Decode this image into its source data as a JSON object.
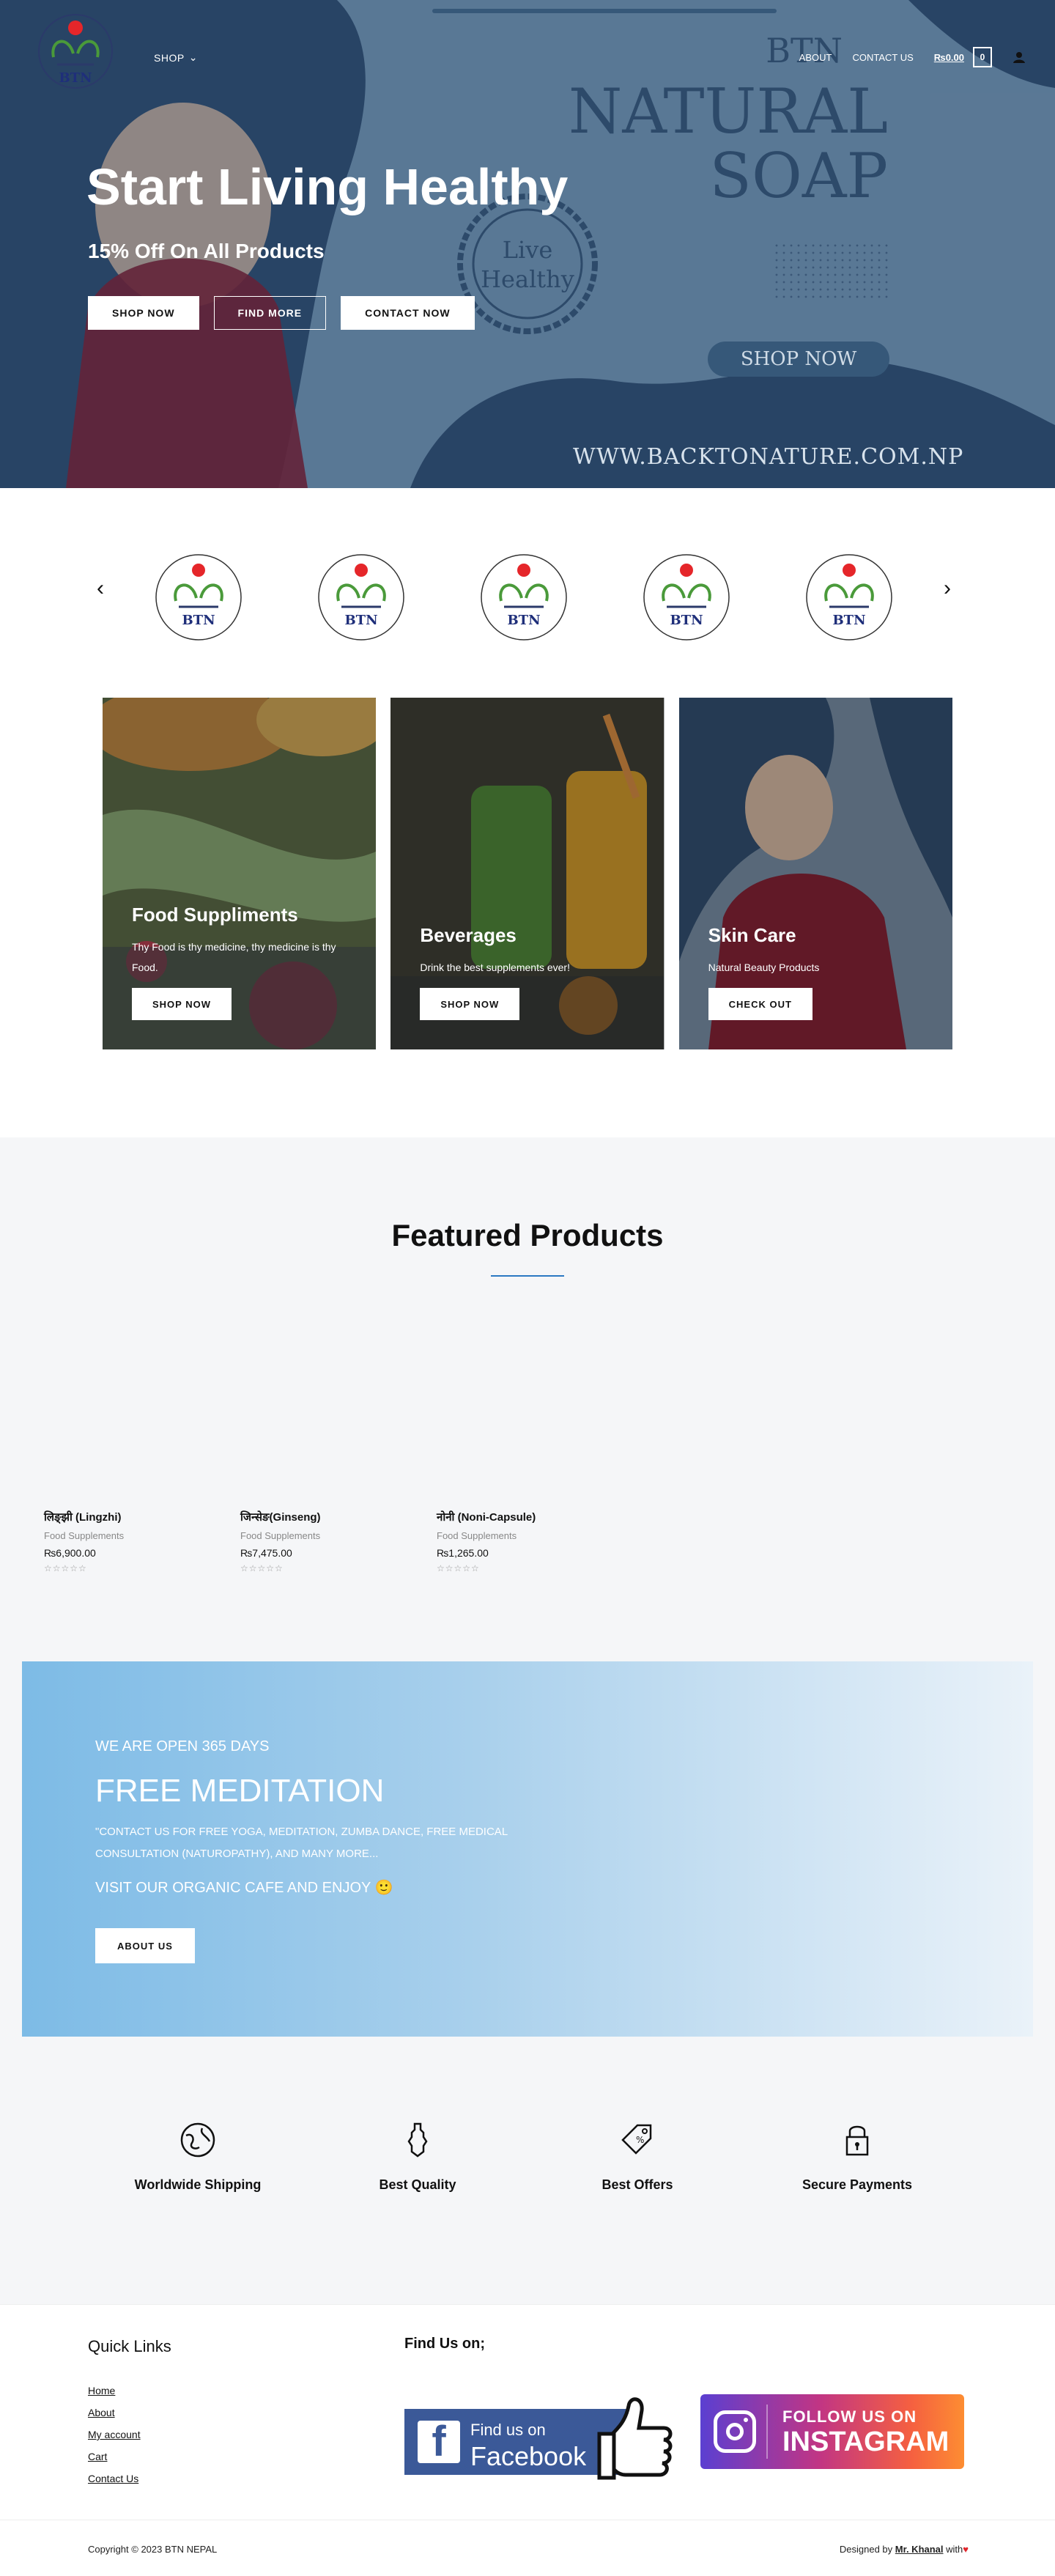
{
  "header": {
    "logo_text": "BTN",
    "nav_shop": "SHOP",
    "nav_about": "ABOUT",
    "nav_contact": "CONTACT US",
    "cart_amount": "₨0.00",
    "cart_count": "0"
  },
  "hero": {
    "title": "Start Living Healthy",
    "subtitle": "15% Off On All Products",
    "buttons": [
      "SHOP NOW",
      "FIND MORE",
      "CONTACT NOW"
    ],
    "brand_small": "BTN",
    "brand_line1": "NATURAL",
    "brand_line2": "SOAP",
    "seal_line1": "Live",
    "seal_line2": "Healthy",
    "shop_pill": "SHOP NOW",
    "url": "WWW.BACKTONATURE.COM.NP"
  },
  "carousel": {
    "prev": "‹",
    "next": "›",
    "logo_text": "BTN"
  },
  "categories": [
    {
      "title": "Food Suppliments",
      "text": "Thy Food is thy medicine, thy medicine is thy Food.",
      "button": "SHOP NOW"
    },
    {
      "title": "Beverages",
      "text": "Drink the best supplements ever!",
      "button": "SHOP NOW"
    },
    {
      "title": "Skin Care",
      "text": "Natural Beauty Products",
      "button": "CHECK OUT"
    }
  ],
  "featured": {
    "title": "Featured Products",
    "products": [
      {
        "name": "लिङ्झी (Lingzhi)",
        "category": "Food Supplements",
        "price": "₨6,900.00",
        "rating": "☆☆☆☆☆"
      },
      {
        "name": "जिन्सेङ(Ginseng)",
        "category": "Food Supplements",
        "price": "₨7,475.00",
        "rating": "☆☆☆☆☆"
      },
      {
        "name": "नोनी (Noni-Capsule)",
        "category": "Food Supplements",
        "price": "₨1,265.00",
        "rating": "☆☆☆☆☆"
      }
    ]
  },
  "meditation": {
    "kicker": "WE ARE OPEN 365 DAYS",
    "title": "FREE MEDITATION",
    "text": "\"CONTACT US FOR FREE YOGA, MEDITATION, ZUMBA DANCE, FREE MEDICAL CONSULTATION (NATUROPATHY), AND MANY MORE...",
    "visit": "VISIT OUR ORGANIC CAFE AND ENJOY 🙂",
    "button": "ABOUT US"
  },
  "features": [
    {
      "label": "Worldwide Shipping",
      "icon": "globe-icon"
    },
    {
      "label": "Best Quality",
      "icon": "medal-icon"
    },
    {
      "label": "Best Offers",
      "icon": "tag-icon"
    },
    {
      "label": "Secure Payments",
      "icon": "lock-icon"
    }
  ],
  "footer": {
    "quick_links_title": "Quick Links",
    "links": [
      "Home",
      "About",
      "My account",
      "Cart",
      "Contact Us"
    ],
    "find_us": "Find Us on;",
    "fb_line1": "Find us on",
    "fb_line2": "Facebook",
    "ig_line1": "FOLLOW US ON",
    "ig_line2": "INSTAGRAM",
    "copyright": "Copyright © 2023 BTN NEPAL",
    "designed_prefix": "Designed by",
    "designer": "Mr. Khanal",
    "designed_suffix": "with"
  },
  "colors": {
    "hero_blue": "#365879",
    "accent_line": "#2b78c2",
    "facebook": "#3b5998"
  }
}
